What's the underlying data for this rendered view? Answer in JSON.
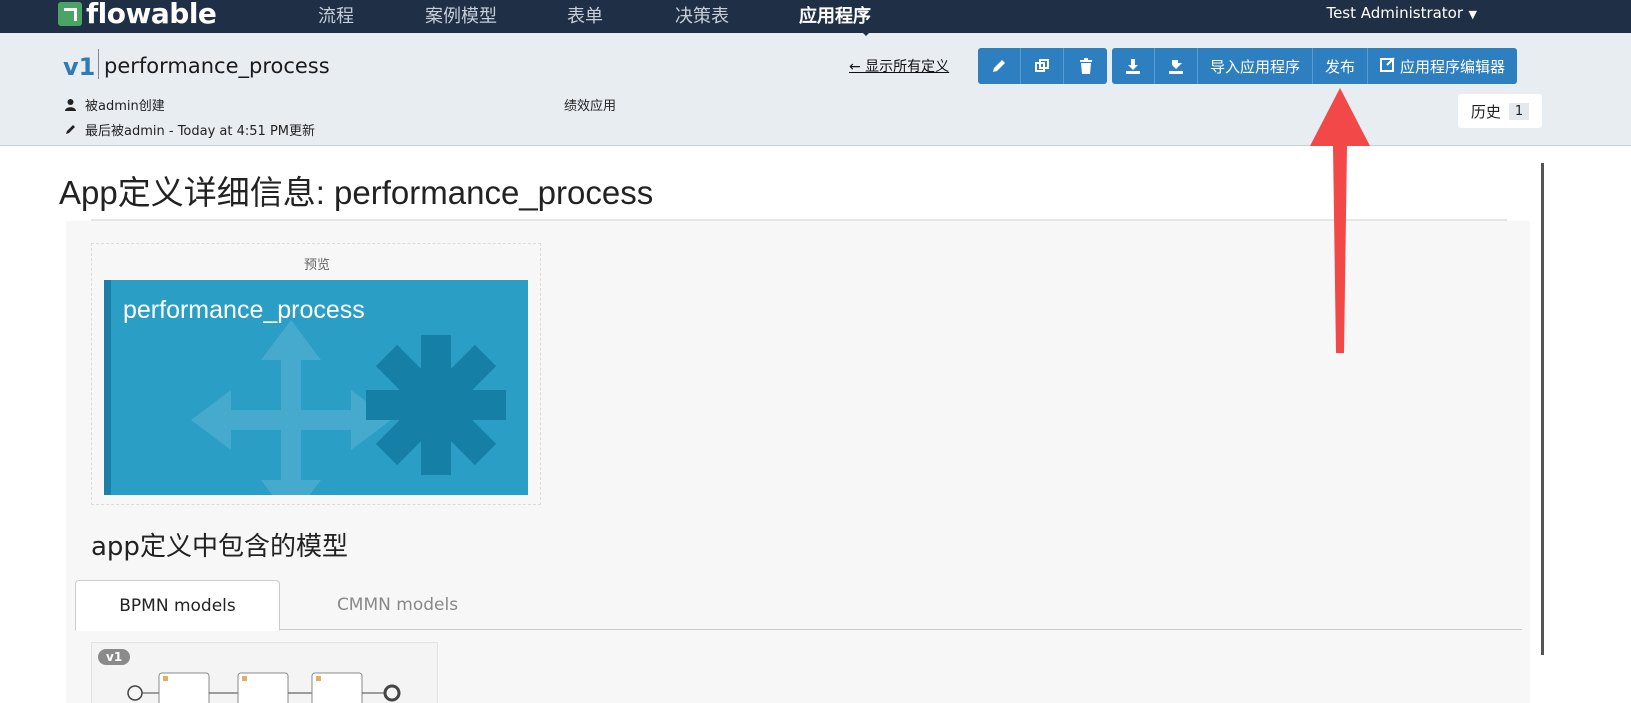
{
  "nav": {
    "logo_text": "flowable",
    "items": [
      "流程",
      "案例模型",
      "表单",
      "决策表",
      "应用程序"
    ],
    "active": "应用程序",
    "user": "Test Administrator"
  },
  "header": {
    "version": "v1",
    "app_name": "performance_process",
    "created_by": "被admin创建",
    "updated_by": "最后被admin - Today at 4:51 PM更新",
    "description": "绩效应用",
    "back_link": "← 显示所有定义",
    "buttons": {
      "edit_icon": "pencil-icon",
      "copy_icon": "copy-icon",
      "delete_icon": "trash-icon",
      "download_icon": "download-icon",
      "publish_icon": "upload-icon",
      "import": "导入应用程序",
      "publish": "发布",
      "editor": "应用程序编辑器"
    },
    "history_label": "历史",
    "history_count": "1"
  },
  "main": {
    "title": "App定义详细信息: performance_process",
    "preview_label": "预览",
    "tile_name": "performance_process",
    "models_heading": "app定义中包含的模型",
    "tabs": [
      "BPMN models",
      "CMMN models"
    ],
    "active_tab": "BPMN models",
    "model_version_badge": "v1"
  },
  "colors": {
    "nav_bg": "#1f2f45",
    "header_bg": "#e8edf2",
    "button_blue": "#2d7fbf",
    "tile_blue": "#2b9ec6",
    "annotation_red": "#f24848"
  }
}
